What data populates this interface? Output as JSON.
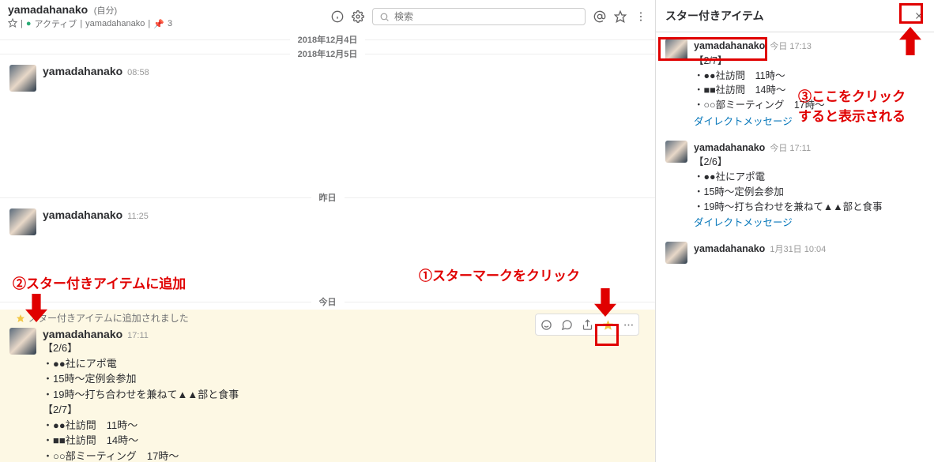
{
  "header": {
    "channel": "yamadahanako",
    "self_label": "(自分)",
    "active_label": "アクティブ",
    "presence_target": "yamadahanako",
    "member_count": "3",
    "search_placeholder": "検索"
  },
  "dividers": {
    "d1": "2018年12月4日",
    "d2": "2018年12月5日",
    "d3": "昨日",
    "d4": "今日"
  },
  "msgs": {
    "m1": {
      "user": "yamadahanako",
      "time": "08:58"
    },
    "m2": {
      "user": "yamadahanako",
      "time": "11:25"
    },
    "m3": {
      "user": "yamadahanako",
      "time": "17:11",
      "star_note": "スター付きアイテムに追加されました",
      "lines": [
        "【2/6】",
        "・●●社にアポ電",
        "・15時～定例会参加",
        "・19時～打ち合わせを兼ねて▲▲部と食事",
        "【2/7】",
        "・●●社訪問　11時～",
        "・■■社訪問　14時～",
        "・○○部ミーティング　17時～"
      ]
    }
  },
  "pane": {
    "title": "スター付きアイテム",
    "items": [
      {
        "user": "yamadahanako",
        "time": "今日 17:13",
        "lines": [
          "【2/7】",
          "・●●社訪問　11時～",
          "・■■社訪問　14時～",
          "・○○部ミーティング　17時～"
        ],
        "src": "ダイレクトメッセージ"
      },
      {
        "user": "yamadahanako",
        "time": "今日 17:11",
        "lines": [
          "【2/6】",
          "・●●社にアポ電",
          "・15時～定例会参加",
          "・19時～打ち合わせを兼ねて▲▲部と食事"
        ],
        "src": "ダイレクトメッセージ"
      },
      {
        "user": "yamadahanako",
        "time": "1月31日 10:04"
      }
    ]
  },
  "anno": {
    "a1": "①スターマークをクリック",
    "a2": "②スター付きアイテムに追加",
    "a3a": "③ここをクリック",
    "a3b": "すると表示される"
  }
}
